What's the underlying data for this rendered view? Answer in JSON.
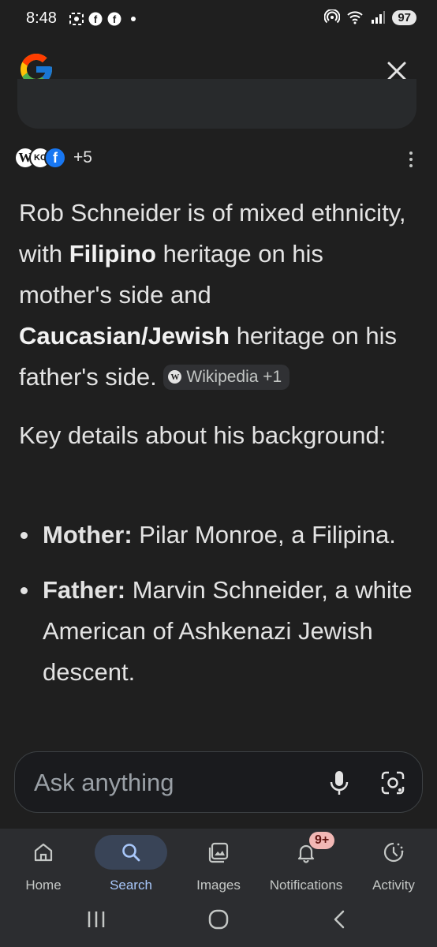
{
  "status_bar": {
    "time": "8:48",
    "battery": "97",
    "icons": [
      "screenshot-icon",
      "facebook-icon",
      "facebook-icon",
      "dot-icon",
      "hotspot-icon",
      "wifi-icon",
      "signal-icon"
    ]
  },
  "header": {
    "logo": "google-g-logo",
    "close_icon": "close-icon"
  },
  "sources": {
    "badges": [
      "W",
      "KC",
      "f"
    ],
    "more": "+5"
  },
  "answer": {
    "p1_a": "Rob Schneider is of mixed ethnicity, with ",
    "p1_b": "Filipino",
    "p1_c": " heritage on his mother's side and ",
    "p1_d": "Caucasian/Jewish",
    "p1_e": " heritage on his father's side.",
    "citation": "Wikipedia +1",
    "p2": "Key details about his background:",
    "bullets": [
      {
        "label": "Mother:",
        "text": " Pilar Monroe, a Filipina."
      },
      {
        "label": "Father:",
        "text": " Marvin Schneider, a white American of Ashkenazi Jewish descent."
      }
    ]
  },
  "ask_bar": {
    "placeholder": "Ask anything"
  },
  "bottom_nav": {
    "items": [
      {
        "label": "Home",
        "icon": "home-icon"
      },
      {
        "label": "Search",
        "icon": "search-icon"
      },
      {
        "label": "Images",
        "icon": "images-icon"
      },
      {
        "label": "Notifications",
        "icon": "bell-icon",
        "badge": "9+"
      },
      {
        "label": "Activity",
        "icon": "activity-icon"
      }
    ]
  },
  "colors": {
    "background": "#1f1f1f",
    "accent": "#a8c7fa",
    "active_pill": "#394457",
    "badge": "#f2b8b5"
  }
}
